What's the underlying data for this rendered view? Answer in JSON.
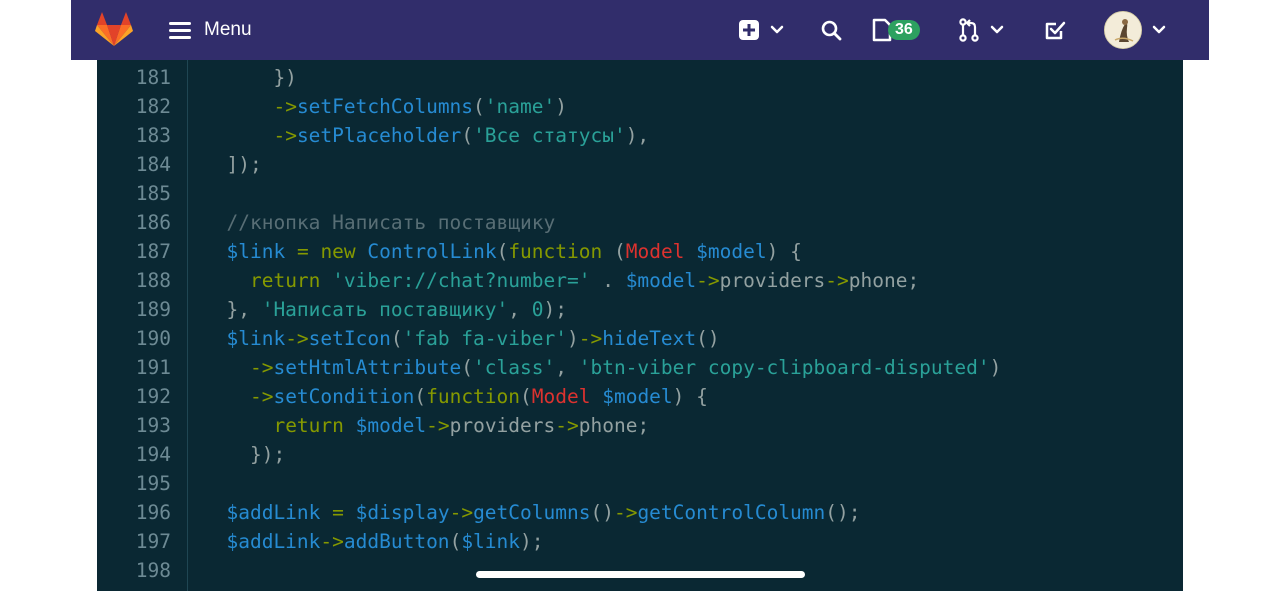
{
  "navbar": {
    "menu_label": "Menu",
    "issues_count": "36",
    "bg_color": "#312d6b"
  },
  "code": {
    "lines": [
      {
        "n": "181",
        "src": "      })"
      },
      {
        "n": "182",
        "src": "      ->setFetchColumns('name')"
      },
      {
        "n": "183",
        "src": "      ->setPlaceholder('Все статусы'),"
      },
      {
        "n": "184",
        "src": "  ]);"
      },
      {
        "n": "185",
        "src": ""
      },
      {
        "n": "186",
        "src": "  //кнопка Написать поставщику"
      },
      {
        "n": "187",
        "src": "  $link = new ControlLink(function (Model $model) {"
      },
      {
        "n": "188",
        "src": "    return 'viber://chat?number=' . $model->providers->phone;"
      },
      {
        "n": "189",
        "src": "  }, 'Написать поставщику', 0);"
      },
      {
        "n": "190",
        "src": "  $link->setIcon('fab fa-viber')->hideText()"
      },
      {
        "n": "191",
        "src": "    ->setHtmlAttribute('class', 'btn-viber copy-clipboard-disputed')"
      },
      {
        "n": "192",
        "src": "    ->setCondition(function(Model $model) {"
      },
      {
        "n": "193",
        "src": "      return $model->providers->phone;"
      },
      {
        "n": "194",
        "src": "    });"
      },
      {
        "n": "195",
        "src": ""
      },
      {
        "n": "196",
        "src": "  $addLink = $display->getColumns()->getControlColumn();"
      },
      {
        "n": "197",
        "src": "  $addLink->addButton($link);"
      },
      {
        "n": "198",
        "src": ""
      }
    ]
  },
  "colors": {
    "code_bg": "#0a2833",
    "keyword": "#859900",
    "function": "#268bd2",
    "string": "#2aa198",
    "class": "#dc322f",
    "comment": "#586e75"
  }
}
